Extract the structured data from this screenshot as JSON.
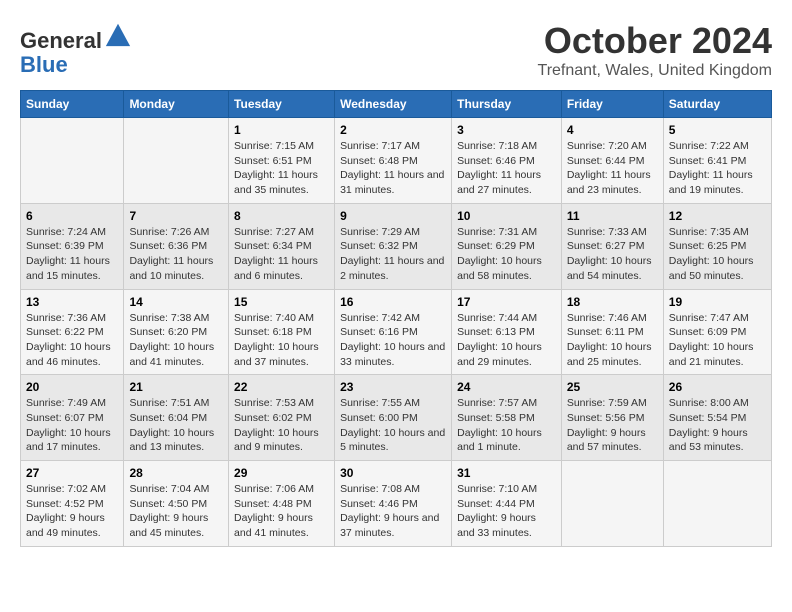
{
  "header": {
    "logo_line1": "General",
    "logo_line2": "Blue",
    "month_title": "October 2024",
    "location": "Trefnant, Wales, United Kingdom"
  },
  "days_of_week": [
    "Sunday",
    "Monday",
    "Tuesday",
    "Wednesday",
    "Thursday",
    "Friday",
    "Saturday"
  ],
  "weeks": [
    [
      {
        "day": "",
        "info": ""
      },
      {
        "day": "",
        "info": ""
      },
      {
        "day": "1",
        "info": "Sunrise: 7:15 AM\nSunset: 6:51 PM\nDaylight: 11 hours and 35 minutes."
      },
      {
        "day": "2",
        "info": "Sunrise: 7:17 AM\nSunset: 6:48 PM\nDaylight: 11 hours and 31 minutes."
      },
      {
        "day": "3",
        "info": "Sunrise: 7:18 AM\nSunset: 6:46 PM\nDaylight: 11 hours and 27 minutes."
      },
      {
        "day": "4",
        "info": "Sunrise: 7:20 AM\nSunset: 6:44 PM\nDaylight: 11 hours and 23 minutes."
      },
      {
        "day": "5",
        "info": "Sunrise: 7:22 AM\nSunset: 6:41 PM\nDaylight: 11 hours and 19 minutes."
      }
    ],
    [
      {
        "day": "6",
        "info": "Sunrise: 7:24 AM\nSunset: 6:39 PM\nDaylight: 11 hours and 15 minutes."
      },
      {
        "day": "7",
        "info": "Sunrise: 7:26 AM\nSunset: 6:36 PM\nDaylight: 11 hours and 10 minutes."
      },
      {
        "day": "8",
        "info": "Sunrise: 7:27 AM\nSunset: 6:34 PM\nDaylight: 11 hours and 6 minutes."
      },
      {
        "day": "9",
        "info": "Sunrise: 7:29 AM\nSunset: 6:32 PM\nDaylight: 11 hours and 2 minutes."
      },
      {
        "day": "10",
        "info": "Sunrise: 7:31 AM\nSunset: 6:29 PM\nDaylight: 10 hours and 58 minutes."
      },
      {
        "day": "11",
        "info": "Sunrise: 7:33 AM\nSunset: 6:27 PM\nDaylight: 10 hours and 54 minutes."
      },
      {
        "day": "12",
        "info": "Sunrise: 7:35 AM\nSunset: 6:25 PM\nDaylight: 10 hours and 50 minutes."
      }
    ],
    [
      {
        "day": "13",
        "info": "Sunrise: 7:36 AM\nSunset: 6:22 PM\nDaylight: 10 hours and 46 minutes."
      },
      {
        "day": "14",
        "info": "Sunrise: 7:38 AM\nSunset: 6:20 PM\nDaylight: 10 hours and 41 minutes."
      },
      {
        "day": "15",
        "info": "Sunrise: 7:40 AM\nSunset: 6:18 PM\nDaylight: 10 hours and 37 minutes."
      },
      {
        "day": "16",
        "info": "Sunrise: 7:42 AM\nSunset: 6:16 PM\nDaylight: 10 hours and 33 minutes."
      },
      {
        "day": "17",
        "info": "Sunrise: 7:44 AM\nSunset: 6:13 PM\nDaylight: 10 hours and 29 minutes."
      },
      {
        "day": "18",
        "info": "Sunrise: 7:46 AM\nSunset: 6:11 PM\nDaylight: 10 hours and 25 minutes."
      },
      {
        "day": "19",
        "info": "Sunrise: 7:47 AM\nSunset: 6:09 PM\nDaylight: 10 hours and 21 minutes."
      }
    ],
    [
      {
        "day": "20",
        "info": "Sunrise: 7:49 AM\nSunset: 6:07 PM\nDaylight: 10 hours and 17 minutes."
      },
      {
        "day": "21",
        "info": "Sunrise: 7:51 AM\nSunset: 6:04 PM\nDaylight: 10 hours and 13 minutes."
      },
      {
        "day": "22",
        "info": "Sunrise: 7:53 AM\nSunset: 6:02 PM\nDaylight: 10 hours and 9 minutes."
      },
      {
        "day": "23",
        "info": "Sunrise: 7:55 AM\nSunset: 6:00 PM\nDaylight: 10 hours and 5 minutes."
      },
      {
        "day": "24",
        "info": "Sunrise: 7:57 AM\nSunset: 5:58 PM\nDaylight: 10 hours and 1 minute."
      },
      {
        "day": "25",
        "info": "Sunrise: 7:59 AM\nSunset: 5:56 PM\nDaylight: 9 hours and 57 minutes."
      },
      {
        "day": "26",
        "info": "Sunrise: 8:00 AM\nSunset: 5:54 PM\nDaylight: 9 hours and 53 minutes."
      }
    ],
    [
      {
        "day": "27",
        "info": "Sunrise: 7:02 AM\nSunset: 4:52 PM\nDaylight: 9 hours and 49 minutes."
      },
      {
        "day": "28",
        "info": "Sunrise: 7:04 AM\nSunset: 4:50 PM\nDaylight: 9 hours and 45 minutes."
      },
      {
        "day": "29",
        "info": "Sunrise: 7:06 AM\nSunset: 4:48 PM\nDaylight: 9 hours and 41 minutes."
      },
      {
        "day": "30",
        "info": "Sunrise: 7:08 AM\nSunset: 4:46 PM\nDaylight: 9 hours and 37 minutes."
      },
      {
        "day": "31",
        "info": "Sunrise: 7:10 AM\nSunset: 4:44 PM\nDaylight: 9 hours and 33 minutes."
      },
      {
        "day": "",
        "info": ""
      },
      {
        "day": "",
        "info": ""
      }
    ]
  ]
}
